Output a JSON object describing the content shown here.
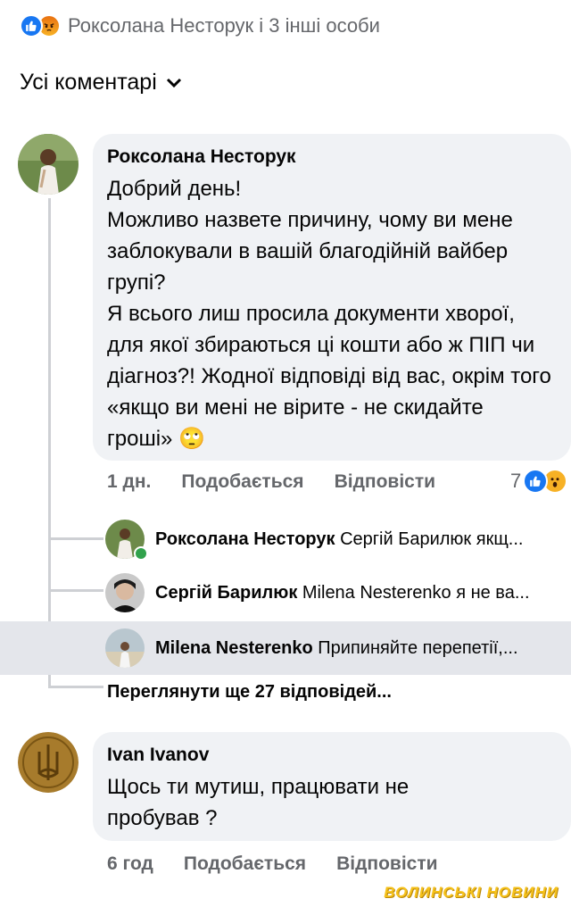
{
  "header": {
    "reactors_text": "Роксолана Несторук і 3 інші особи",
    "reactions": [
      "like-icon",
      "angry-icon"
    ]
  },
  "filter": {
    "label": "Усі коментарі"
  },
  "comment1": {
    "author": "Роксолана Несторук",
    "text": "Добрий день!\nМожливо назвете причину, чому ви мене заблокували в вашій благодійній вайбер групі?\nЯ всього лиш просила документи хворої, для якої збираються ці кошти або ж ПІП чи діагноз?! Жодної відповіді від вас, окрім того «якщо ви мені не вірите - не скидайте гроші» 🙄",
    "time": "1 дн.",
    "like_label": "Подобається",
    "reply_label": "Відповісти",
    "reaction_count": "7",
    "reactions": [
      "like-icon",
      "wow-icon"
    ]
  },
  "replies": [
    {
      "author": "Роксолана Несторук",
      "preview": "Сергій Барилюк якщ..."
    },
    {
      "author": "Сергій Барилюк",
      "preview": "Milena Nesterenko я не ва..."
    },
    {
      "author": "Milena Nesterenko",
      "preview": "Припиняйте  перепетії,..."
    }
  ],
  "more_replies": {
    "label": "Переглянути ще 27 відповідей..."
  },
  "comment2": {
    "author": "Ivan Ivanov",
    "text": "Щось ти мутиш, працювати не пробував ?",
    "time": "6 год",
    "like_label": "Подобається",
    "reply_label": "Відповісти"
  },
  "watermark": "ВОЛИНСЬКІ НОВИНИ",
  "colors": {
    "like_blue": "#1877f2",
    "bubble_bg": "#f0f2f5",
    "meta_gray": "#65676b",
    "online_green": "#31a24c",
    "highlight_row": "#e4e6eb"
  }
}
